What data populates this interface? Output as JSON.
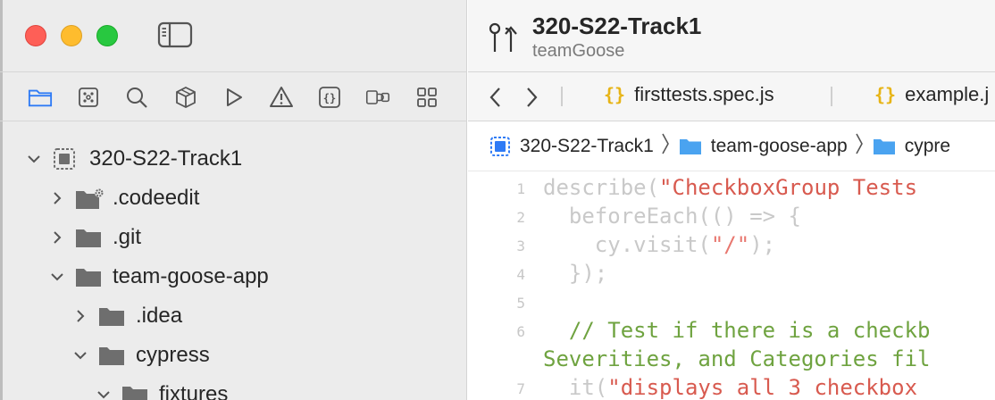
{
  "sidebar": {
    "nav_tabs": [
      "folder-icon",
      "source-control-icon",
      "search-icon",
      "cube-icon",
      "play-icon",
      "warning-icon",
      "braces-icon",
      "plugin-icon",
      "grid-icon"
    ],
    "tree": [
      {
        "label": "320-S22-Track1",
        "kind": "project",
        "expanded": true
      },
      {
        "label": ".codeedit",
        "kind": "folder-gear",
        "expanded": false
      },
      {
        "label": ".git",
        "kind": "folder",
        "expanded": false
      },
      {
        "label": "team-goose-app",
        "kind": "folder",
        "expanded": true
      },
      {
        "label": ".idea",
        "kind": "folder",
        "expanded": false
      },
      {
        "label": "cypress",
        "kind": "folder",
        "expanded": true
      },
      {
        "label": "fixtures",
        "kind": "folder",
        "expanded": true
      }
    ]
  },
  "titlebar": {
    "title": "320-S22-Track1",
    "subtitle": "teamGoose"
  },
  "tabs": [
    {
      "label": "firsttests.spec.js",
      "icon": "{}"
    },
    {
      "label": "example.j",
      "icon": "{}"
    }
  ],
  "breadcrumb": [
    "320-S22-Track1",
    "team-goose-app",
    "cypre"
  ],
  "editor": {
    "lines": [
      {
        "num": "1",
        "code": "describe(",
        "str": "\"CheckboxGroup Tests"
      },
      {
        "num": "2",
        "code": "  beforeEach(() => {"
      },
      {
        "num": "3",
        "code": "    cy.visit(",
        "str": "\"/\"",
        "tail": ");"
      },
      {
        "num": "4",
        "code": "  });"
      },
      {
        "num": "5",
        "code": ""
      },
      {
        "num": "6",
        "comment": "  // Test if there is a checkb"
      },
      {
        "num": "",
        "comment": "Severities, and Categories fil"
      },
      {
        "num": "7",
        "code": "  it(",
        "str": "\"displays all 3 checkbox"
      }
    ]
  },
  "colors": {
    "sidebar_bg": "#ececec",
    "accent": "#2f7bf5",
    "folder": "#6e6e6e",
    "string": "#e8776f",
    "comment": "#6fa340",
    "brace": "#e7b416"
  }
}
